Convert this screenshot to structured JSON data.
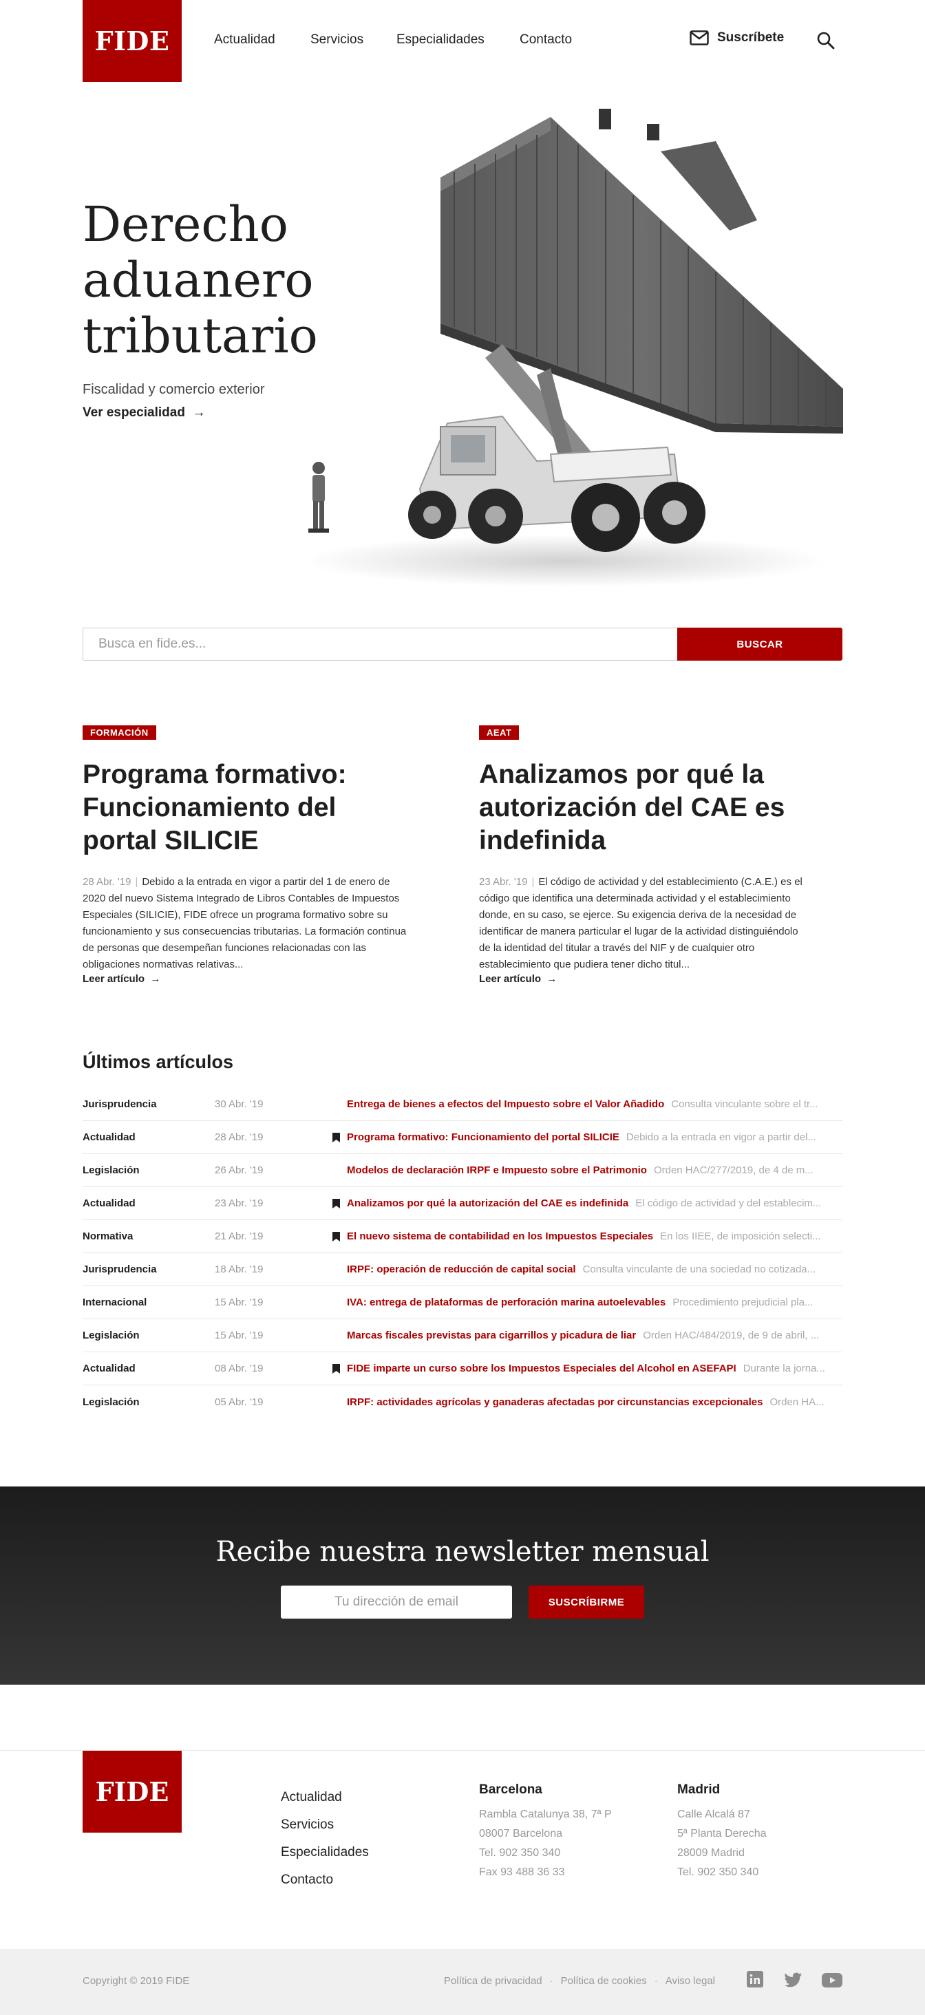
{
  "header": {
    "logo": "FIDE",
    "nav": [
      "Actualidad",
      "Servicios",
      "Especialidades",
      "Contacto"
    ],
    "subscribe_label": "Suscríbete"
  },
  "hero": {
    "title_lines": [
      "Derecho",
      "aduanero",
      "tributario"
    ],
    "subtitle": "Fiscalidad y comercio exterior",
    "link_label": "Ver especialidad",
    "link_arrow": "→"
  },
  "search": {
    "placeholder": "Busca en fide.es...",
    "button_label": "BUSCAR"
  },
  "featured": [
    {
      "badge": "FORMACIÓN",
      "title": "Programa formativo: Funcionamiento del portal SILICIE",
      "date": "28 Abr. '19",
      "excerpt": "Debido a la entrada en vigor a partir del 1 de enero de 2020 del nuevo Sistema Integrado de Libros Contables de Impuestos Especiales (SILICIE), FIDE ofrece un programa formativo sobre su funcionamiento y sus consecuencias tributarias. La formación continua de personas que desempeñan funciones relacionadas con las obligaciones normativas relativas...",
      "read_label": "Leer artículo",
      "arrow": "→"
    },
    {
      "badge": "AEAT",
      "title": "Analizamos por qué la autorización del CAE es indefinida",
      "date": "23 Abr. '19",
      "excerpt": "El código de actividad y del establecimiento (C.A.E.) es el código que identifica una determinada actividad y el establecimiento donde, en su caso, se ejerce. Su exigencia deriva de la necesidad de identificar de manera particular el lugar de la actividad distinguiéndolo de la identidad del titular a través del NIF y de cualquier otro establecimiento que pudiera tener dicho titul...",
      "read_label": "Leer artículo",
      "arrow": "→"
    }
  ],
  "latest": {
    "title": "Últimos artículos",
    "rows": [
      {
        "category": "Jurisprudencia",
        "date": "30 Abr. '19",
        "bookmark": false,
        "title": "Entrega de bienes a efectos del Impuesto sobre el Valor Añadido",
        "desc": "Consulta vinculante sobre el tr..."
      },
      {
        "category": "Actualidad",
        "date": "28 Abr. '19",
        "bookmark": true,
        "title": "Programa formativo: Funcionamiento del portal SILICIE",
        "desc": "Debido a la entrada en vigor a partir del..."
      },
      {
        "category": "Legislación",
        "date": "26 Abr. '19",
        "bookmark": false,
        "title": "Modelos de declaración IRPF e Impuesto sobre el Patrimonio",
        "desc": "Orden HAC/277/2019, de 4 de m..."
      },
      {
        "category": "Actualidad",
        "date": "23 Abr. '19",
        "bookmark": true,
        "title": "Analizamos por qué la autorización del CAE es indefinida",
        "desc": "El código de actividad y del establecim..."
      },
      {
        "category": "Normativa",
        "date": "21 Abr. '19",
        "bookmark": true,
        "title": "El nuevo sistema de contabilidad en los Impuestos Especiales",
        "desc": "En los IIEE, de imposición selecti..."
      },
      {
        "category": "Jurisprudencia",
        "date": "18 Abr. '19",
        "bookmark": false,
        "title": "IRPF: operación de reducción de capital social",
        "desc": "Consulta vinculante de una sociedad no cotizada..."
      },
      {
        "category": "Internacional",
        "date": "15 Abr. '19",
        "bookmark": false,
        "title": "IVA: entrega de plataformas de perforación marina autoelevables",
        "desc": "Procedimiento prejudicial pla..."
      },
      {
        "category": "Legislación",
        "date": "15 Abr. '19",
        "bookmark": false,
        "title": "Marcas fiscales previstas para cigarrillos y picadura de liar",
        "desc": "Orden HAC/484/2019, de 9 de abril, ..."
      },
      {
        "category": "Actualidad",
        "date": "08 Abr. '19",
        "bookmark": true,
        "title": "FIDE imparte un curso sobre los Impuestos Especiales del Alcohol en ASEFAPI",
        "desc": "Durante la jorna..."
      },
      {
        "category": "Legislación",
        "date": "05 Abr. '19",
        "bookmark": false,
        "title": "IRPF: actividades agrícolas y ganaderas afectadas por circunstancias excepcionales",
        "desc": "Orden HA..."
      }
    ]
  },
  "newsletter": {
    "title": "Recibe nuestra newsletter mensual",
    "placeholder": "Tu dirección de email",
    "button_label": "SUSCRÍBIRME"
  },
  "footer": {
    "logo": "FIDE",
    "links": [
      "Actualidad",
      "Servicios",
      "Especialidades",
      "Contacto"
    ],
    "offices": [
      {
        "city": "Barcelona",
        "lines": [
          "Rambla Catalunya 38, 7ª P",
          "08007 Barcelona",
          "Tel. 902 350 340",
          "Fax 93 488 36 33"
        ]
      },
      {
        "city": "Madrid",
        "lines": [
          "Calle Alcalá 87",
          "5ª Planta Derecha",
          "28009 Madrid",
          "Tel. 902 350 340"
        ]
      }
    ],
    "copyright": "Copyright © 2019 FIDE",
    "legal": [
      "Política de privacidad",
      "Política de cookies",
      "Aviso legal"
    ],
    "social_icons": [
      "linkedin-icon",
      "twitter-icon",
      "youtube-icon"
    ]
  },
  "colors": {
    "brand": "#ab0000",
    "dark": "#1f1f1f",
    "muted": "#999999"
  }
}
